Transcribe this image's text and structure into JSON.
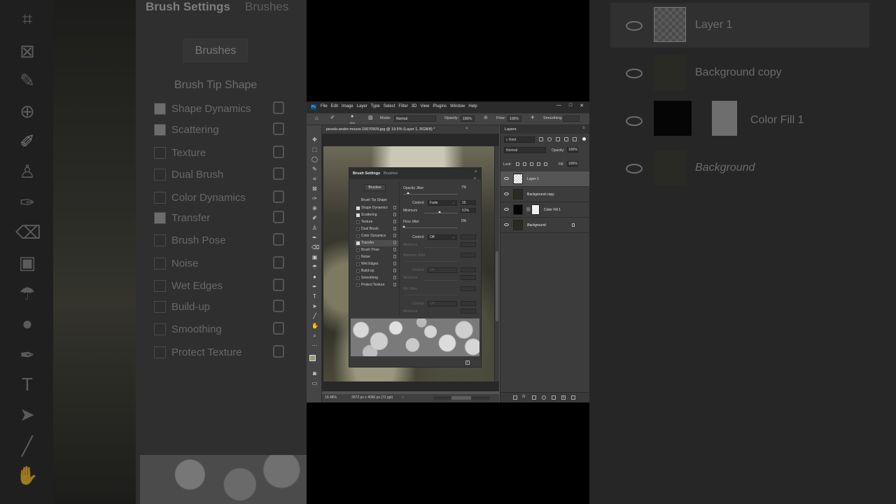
{
  "background_left": {
    "panel_title": "Brush Settings",
    "panel_tab2": "Brushes",
    "brushes_button": "Brushes",
    "tip_shape": "Brush Tip Shape",
    "rows": [
      {
        "label": "Shape Dynamics",
        "checked": true
      },
      {
        "label": "Scattering",
        "checked": true
      },
      {
        "label": "Texture",
        "checked": false
      },
      {
        "label": "Dual Brush",
        "checked": false
      },
      {
        "label": "Color Dynamics",
        "checked": false
      },
      {
        "label": "Transfer",
        "checked": true
      },
      {
        "label": "Brush Pose",
        "checked": false
      },
      {
        "label": "Noise",
        "checked": false
      },
      {
        "label": "Wet Edges",
        "checked": false
      },
      {
        "label": "Build-up",
        "checked": false
      },
      {
        "label": "Smoothing",
        "checked": false
      },
      {
        "label": "Protect Texture",
        "checked": false
      }
    ]
  },
  "background_right": {
    "layers": [
      "Layer 1",
      "Background copy",
      "Color Fill 1",
      "Background"
    ]
  },
  "window": {
    "logo": "Ps",
    "menu": [
      "File",
      "Edit",
      "Image",
      "Layer",
      "Type",
      "Select",
      "Filter",
      "3D",
      "View",
      "Plugins",
      "Window",
      "Help"
    ],
    "controls": [
      "—",
      "□",
      "✕"
    ]
  },
  "options_bar": {
    "brush_size": "504",
    "mode_label": "Mode:",
    "mode_value": "Normal",
    "opacity_label": "Opacity:",
    "opacity_value": "100%",
    "flow_label": "Flow:",
    "flow_value": "100%",
    "smoothing_label": "Smoothing:"
  },
  "document": {
    "tab_title": "pexels-andre-moura-15670509.jpg @ 19.5% (Layer 1, RGB/8) *",
    "zoom": "19.48%",
    "dimensions": "3072 px x 4096 px (72 ppi)"
  },
  "brush_settings": {
    "tab_active": "Brush Settings",
    "tab_other": "Brushes",
    "brushes_button": "Brushes",
    "tip_shape": "Brush Tip Shape",
    "items": [
      {
        "label": "Shape Dynamics",
        "checked": true
      },
      {
        "label": "Scattering",
        "checked": true
      },
      {
        "label": "Texture",
        "checked": false
      },
      {
        "label": "Dual Brush",
        "checked": false
      },
      {
        "label": "Color Dynamics",
        "checked": false
      },
      {
        "label": "Transfer",
        "checked": true
      },
      {
        "label": "Brush Pose",
        "checked": false
      },
      {
        "label": "Noise",
        "checked": false
      },
      {
        "label": "Wet Edges",
        "checked": false
      },
      {
        "label": "Build-up",
        "checked": false
      },
      {
        "label": "Smoothing",
        "checked": false
      },
      {
        "label": "Protect Texture",
        "checked": false
      }
    ],
    "opacity_jitter_label": "Opacity Jitter",
    "opacity_jitter_value": "7%",
    "control_label": "Control:",
    "control_fade": "Fade",
    "fade_steps": "25",
    "minimum_label": "Minimum",
    "minimum_value": "51%",
    "flow_jitter_label": "Flow Jitter",
    "flow_jitter_value": "0%",
    "control_off": "Off",
    "wetness_jitter_label": "Wetness Jitter",
    "mix_jitter_label": "Mix Jitter"
  },
  "layers_panel": {
    "title": "Layers",
    "kind": "Kind",
    "blend_mode": "Normal",
    "opacity_label": "Opacity:",
    "opacity_value": "100%",
    "lock_label": "Lock:",
    "fill_label": "Fill:",
    "fill_value": "100%",
    "layers": [
      {
        "name": "Layer 1",
        "italic": false,
        "selected": true
      },
      {
        "name": "Background copy",
        "italic": false,
        "selected": false
      },
      {
        "name": "Color Fill 1",
        "italic": false,
        "selected": false
      },
      {
        "name": "Background",
        "italic": true,
        "selected": false
      }
    ],
    "footer_fx": "fx"
  }
}
